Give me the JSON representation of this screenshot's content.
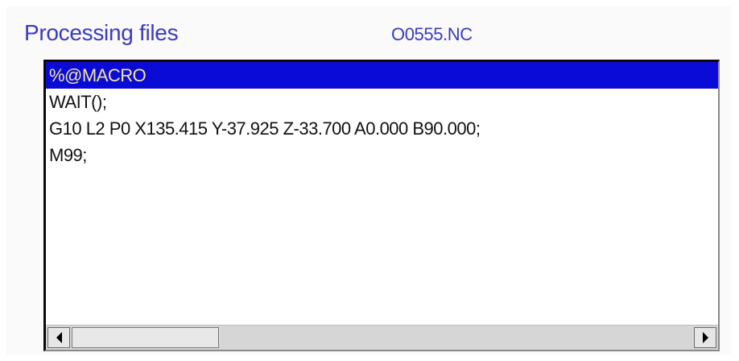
{
  "header": {
    "title": "Processing files",
    "filename": "O0555.NC"
  },
  "editor": {
    "lines": [
      "%@MACRO",
      "WAIT();",
      "G10 L2 P0 X135.415 Y-37.925 Z-33.700 A0.000 B90.000;",
      "M99;"
    ],
    "selected_line": 0
  },
  "colors": {
    "title": "#3a3ac4",
    "selection_bg": "#0b0bd8",
    "selection_text": "#f0e6a0"
  },
  "icons": {
    "scroll_left": "scroll-left-arrow-icon",
    "scroll_right": "scroll-right-arrow-icon"
  }
}
